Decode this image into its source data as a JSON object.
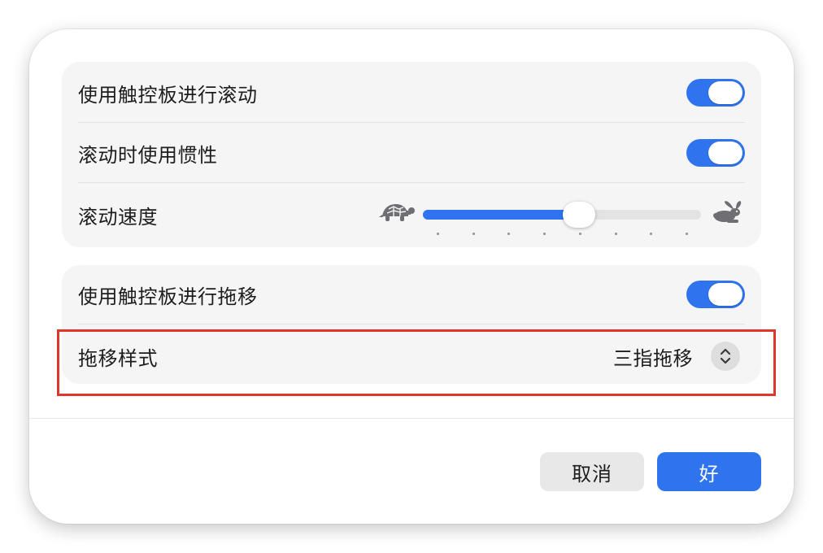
{
  "scroll_group": {
    "scroll_with_trackpad": {
      "label": "使用触控板进行滚动",
      "enabled": true
    },
    "inertia": {
      "label": "滚动时使用惯性",
      "enabled": true
    },
    "speed": {
      "label": "滚动速度",
      "value_fraction": 0.56,
      "tick_count": 8,
      "slow_icon": "turtle-icon",
      "fast_icon": "rabbit-icon"
    }
  },
  "drag_group": {
    "drag_with_trackpad": {
      "label": "使用触控板进行拖移",
      "enabled": true
    },
    "drag_style": {
      "label": "拖移样式",
      "value": "三指拖移",
      "icon": "chevron-up-down-icon"
    }
  },
  "buttons": {
    "cancel": "取消",
    "ok": "好"
  },
  "colors": {
    "accent": "#2f74ee",
    "highlight": "#e0352b"
  }
}
